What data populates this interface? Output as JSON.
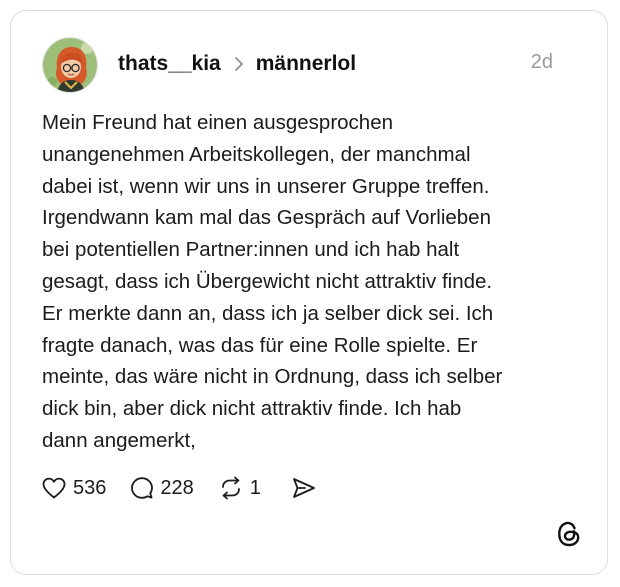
{
  "post": {
    "author": "thats__kia",
    "community": "männerlol",
    "time": "2d",
    "text": "Mein Freund hat einen ausgesprochen\nunangenehmen Arbeitskollegen, der manchmal\ndabei ist, wenn wir uns in unserer Gruppe treffen.\nIrgendwann kam mal das Gespräch auf Vorlieben\nbei potentiellen Partner:innen und ich hab halt\ngesagt, dass ich Übergewicht nicht attraktiv finde.\nEr merkte dann an, dass ich ja selber dick sei. Ich\nfragte danach, was das für eine Rolle spielte. Er\nmeinte, das wäre nicht in Ordnung, dass ich selber\ndick bin, aber dick nicht attraktiv finde. Ich hab\ndann angemerkt,",
    "likes": "536",
    "comments": "228",
    "reposts": "1"
  },
  "icons": {
    "avatar": "avatar-illustration",
    "separator": "chevron-right-icon",
    "like": "heart-icon",
    "comment": "speech-bubble-icon",
    "repost": "repost-icon",
    "share": "send-icon",
    "logo": "threads-logo-icon"
  },
  "colors": {
    "text": "#1b1b1b",
    "muted": "#9a9a9a",
    "border": "#dedede",
    "avatar_bg": "#9ebf7a",
    "avatar_hair": "#d45a2a"
  }
}
